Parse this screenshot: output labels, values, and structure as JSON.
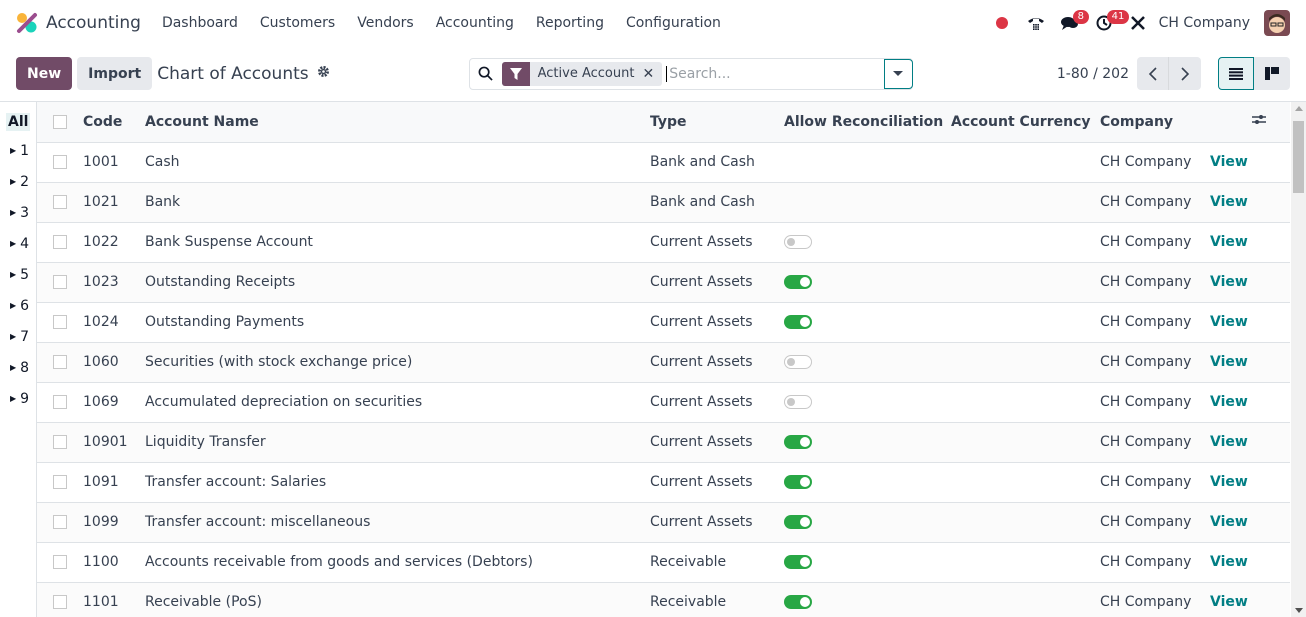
{
  "navbar": {
    "app_name": "Accounting",
    "menu": [
      "Dashboard",
      "Customers",
      "Vendors",
      "Accounting",
      "Reporting",
      "Configuration"
    ],
    "messages_count": "8",
    "activities_count": "41",
    "company": "CH Company"
  },
  "control": {
    "new_label": "New",
    "import_label": "Import",
    "title": "Chart of Accounts",
    "facet_label": "Active Account",
    "search_placeholder": "Search...",
    "pager_value": "1-80 / 202"
  },
  "sidepanel": {
    "all_label": "All",
    "groups": [
      "1",
      "2",
      "3",
      "4",
      "5",
      "6",
      "7",
      "8",
      "9"
    ]
  },
  "table": {
    "columns": [
      "Code",
      "Account Name",
      "Type",
      "Allow Reconciliation",
      "Account Currency",
      "Company"
    ],
    "view_label": "View",
    "rows": [
      {
        "code": "1001",
        "name": "Cash",
        "type": "Bank and Cash",
        "reconcile": null,
        "currency": "",
        "company": "CH Company"
      },
      {
        "code": "1021",
        "name": "Bank",
        "type": "Bank and Cash",
        "reconcile": null,
        "currency": "",
        "company": "CH Company"
      },
      {
        "code": "1022",
        "name": "Bank Suspense Account",
        "type": "Current Assets",
        "reconcile": false,
        "currency": "",
        "company": "CH Company"
      },
      {
        "code": "1023",
        "name": "Outstanding Receipts",
        "type": "Current Assets",
        "reconcile": true,
        "currency": "",
        "company": "CH Company"
      },
      {
        "code": "1024",
        "name": "Outstanding Payments",
        "type": "Current Assets",
        "reconcile": true,
        "currency": "",
        "company": "CH Company"
      },
      {
        "code": "1060",
        "name": "Securities (with stock exchange price)",
        "type": "Current Assets",
        "reconcile": false,
        "currency": "",
        "company": "CH Company"
      },
      {
        "code": "1069",
        "name": "Accumulated depreciation on securities",
        "type": "Current Assets",
        "reconcile": false,
        "currency": "",
        "company": "CH Company"
      },
      {
        "code": "10901",
        "name": "Liquidity Transfer",
        "type": "Current Assets",
        "reconcile": true,
        "currency": "",
        "company": "CH Company"
      },
      {
        "code": "1091",
        "name": "Transfer account: Salaries",
        "type": "Current Assets",
        "reconcile": true,
        "currency": "",
        "company": "CH Company"
      },
      {
        "code": "1099",
        "name": "Transfer account: miscellaneous",
        "type": "Current Assets",
        "reconcile": true,
        "currency": "",
        "company": "CH Company"
      },
      {
        "code": "1100",
        "name": "Accounts receivable from goods and services (Debtors)",
        "type": "Receivable",
        "reconcile": true,
        "currency": "",
        "company": "CH Company"
      },
      {
        "code": "1101",
        "name": "Receivable (PoS)",
        "type": "Receivable",
        "reconcile": true,
        "currency": "",
        "company": "CH Company"
      }
    ]
  },
  "colors": {
    "brand": "#714b67",
    "accent": "#017e84",
    "toggle_on": "#28a745",
    "badge": "#dc3545"
  }
}
